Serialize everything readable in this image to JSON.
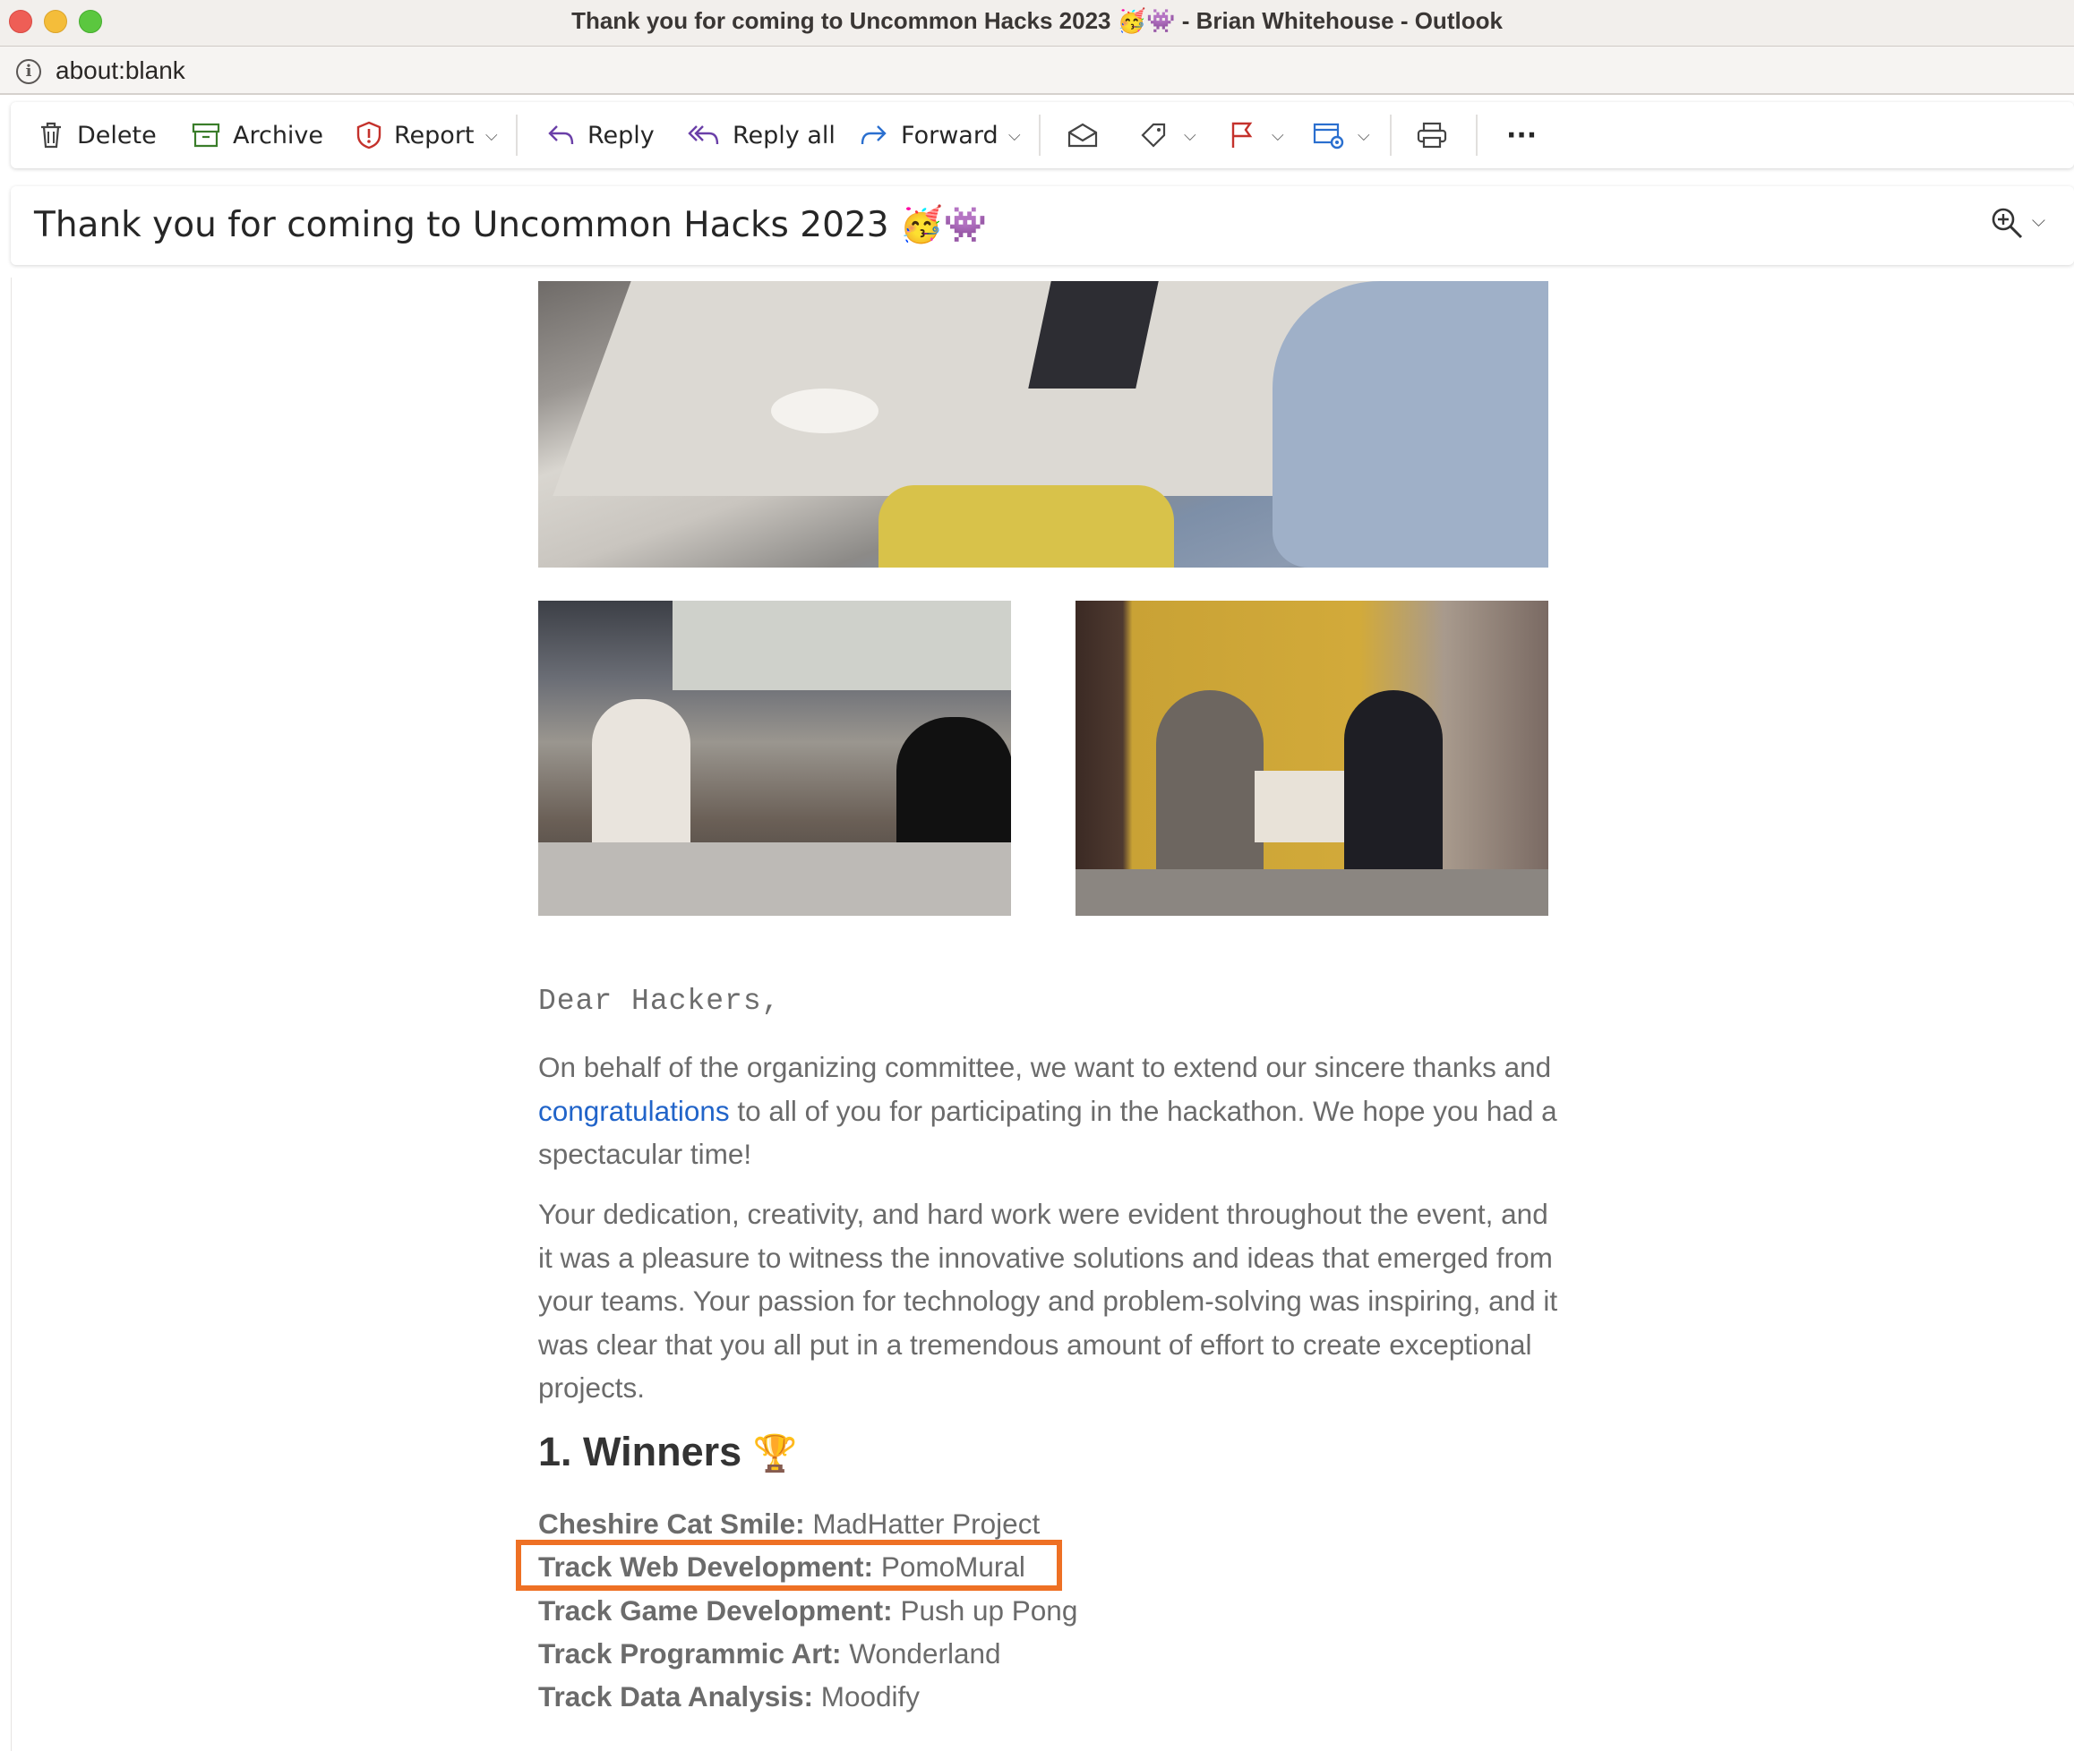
{
  "window": {
    "title": "Thank you for coming to Uncommon Hacks 2023 🥳👾 - Brian Whitehouse - Outlook"
  },
  "address": {
    "url": "about:blank"
  },
  "toolbar": {
    "delete": "Delete",
    "archive": "Archive",
    "report": "Report",
    "reply": "Reply",
    "reply_all": "Reply all",
    "forward": "Forward",
    "more": "···"
  },
  "message": {
    "subject": "Thank you for coming to Uncommon Hacks 2023 🥳👾",
    "greeting": "Dear Hackers,",
    "para1_before": "On behalf of the organizing committee, we want to extend our sincere thanks and ",
    "para1_link": "congratulations",
    "para1_after": " to all of you for participating in the hackathon. We hope you had a spectacular time!",
    "para2": "Your dedication, creativity, and hard work were evident throughout the event, and it was a pleasure to witness the innovative solutions and ideas that emerged from your teams. Your passion for technology and problem-solving was inspiring, and it was clear that you all put in a tremendous amount of effort to create exceptional projects.",
    "winners_heading": "1. Winners",
    "winners_emoji": "🏆",
    "winners": [
      {
        "track": "Cheshire Cat Smile:",
        "project": "MadHatter Project"
      },
      {
        "track": "Track Web Development:",
        "project": "PomoMural"
      },
      {
        "track": "Track Game Development:",
        "project": "Push up Pong"
      },
      {
        "track": "Track Programmic Art:",
        "project": "Wonderland"
      },
      {
        "track": "Track Data Analysis:",
        "project": "Moodify"
      }
    ]
  },
  "colors": {
    "highlight_box": "#ee7024",
    "link": "#2164c9",
    "report_icon": "#c4312b",
    "flag_icon": "#c4312b",
    "reply_icon": "#6a3fa8",
    "forward_icon": "#2a6fcf",
    "archive_icon": "#3a7d2a"
  }
}
